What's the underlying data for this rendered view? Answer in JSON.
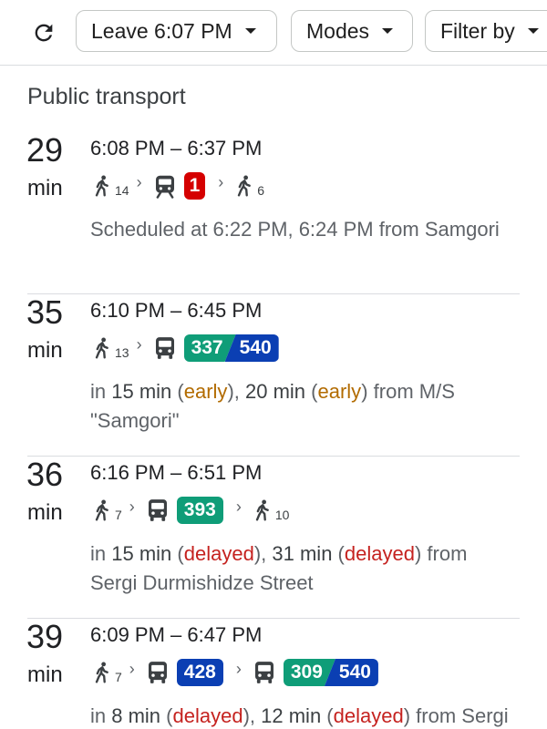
{
  "toolbar": {
    "refresh_icon": "refresh-icon",
    "leave_label": "Leave 6:07 PM",
    "modes_label": "Modes",
    "filter_label": "Filter by"
  },
  "section_title": "Public transport",
  "colors": {
    "early": "#b26b00",
    "delayed": "#c5221f",
    "green_line": "#0f9d78",
    "blue_line": "#0b3fb3",
    "tram_red": "#d50000"
  },
  "routes": [
    {
      "duration": "29",
      "unit": "min",
      "times": "6:08 PM – 6:37 PM",
      "walk1": "14",
      "vehicle": "tram-icon",
      "line": "1",
      "walk2": "6",
      "desc": "Scheduled at 6:22 PM, 6:24 PM from Samgori"
    },
    {
      "duration": "35",
      "unit": "min",
      "times": "6:10 PM – 6:45 PM",
      "walk1": "13",
      "vehicle": "bus-icon",
      "line_a": "337",
      "line_b": "540",
      "t1": "15 min",
      "s1": "early",
      "t2": "20 min",
      "s2": "early",
      "desc_from": "from M/S \"Samgori\""
    },
    {
      "duration": "36",
      "unit": "min",
      "times": "6:16 PM – 6:51 PM",
      "walk1": "7",
      "vehicle": "bus-icon",
      "line": "393",
      "walk2": "10",
      "t1": "15 min",
      "s1": "delayed",
      "t2": "31 min",
      "s2": "delayed",
      "desc_from": "from Sergi Durmishidze Street"
    },
    {
      "duration": "39",
      "unit": "min",
      "times": "6:09 PM – 6:47 PM",
      "walk1": "7",
      "vehicle": "bus-icon",
      "line": "428",
      "line_a": "309",
      "line_b": "540",
      "t1": "8 min",
      "s1": "delayed",
      "t2": "12 min",
      "s2": "delayed",
      "desc_from": "from Sergi Durmishidze Street"
    }
  ]
}
